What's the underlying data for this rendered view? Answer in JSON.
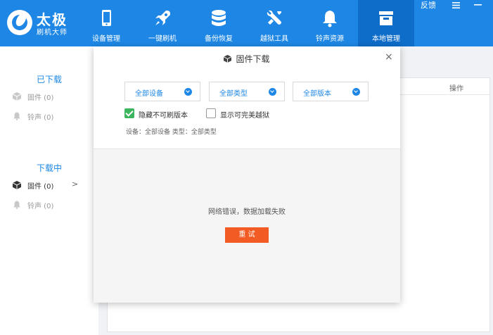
{
  "app": {
    "title": "太极",
    "subtitle": "刷机大师"
  },
  "nav": {
    "items": [
      {
        "label": "设备管理",
        "icon": "phone-icon"
      },
      {
        "label": "一键刷机",
        "icon": "rocket-icon"
      },
      {
        "label": "备份恢复",
        "icon": "database-icon"
      },
      {
        "label": "越狱工具",
        "icon": "wrench-icon"
      },
      {
        "label": "铃声资源",
        "icon": "bell-icon"
      },
      {
        "label": "本地管理",
        "icon": "storage-box-icon"
      }
    ],
    "active_index": 5
  },
  "window": {
    "feedback": "反馈",
    "menu_icon": "hamburger-icon",
    "minimize_icon": "minimize-icon"
  },
  "sidebar": {
    "downloaded": {
      "heading": "已下载",
      "items": [
        {
          "label": "固件 (0)",
          "icon": "box-icon"
        },
        {
          "label": "铃声 (0)",
          "icon": "bell-icon"
        }
      ]
    },
    "downloading": {
      "heading": "下载中",
      "items": [
        {
          "label": "固件 (0)",
          "icon": "box-icon",
          "chevron": ">"
        },
        {
          "label": "铃声 (0)",
          "icon": "bell-icon"
        }
      ]
    }
  },
  "main": {
    "column_action": "操作"
  },
  "dialog": {
    "title": "固件下载",
    "close": "×",
    "filters": [
      {
        "label": "全部设备"
      },
      {
        "label": "全部类型"
      },
      {
        "label": "全部版本"
      }
    ],
    "checkboxes": [
      {
        "label": "隐藏不可刷版本",
        "checked": true
      },
      {
        "label": "显示可完美越狱",
        "checked": false
      }
    ],
    "summary": "设备：全部设备 类型：全部类型",
    "error": "网络错误，数据加载失败",
    "retry": "重 试"
  },
  "colors": {
    "brand": "#1e87e5",
    "active_nav": "#0e6dc9",
    "retry": "#f25b24",
    "check": "#3db55e"
  }
}
